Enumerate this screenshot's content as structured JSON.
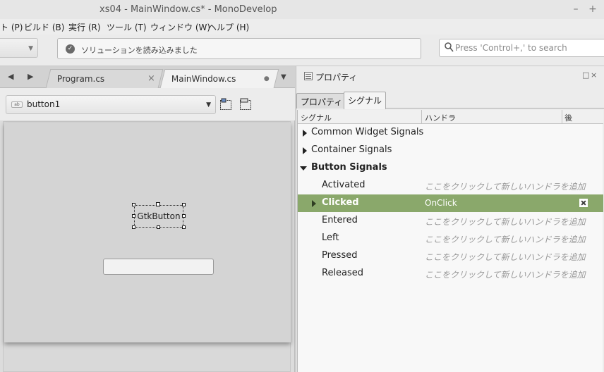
{
  "window": {
    "title": "xs04 - MainWindow.cs* - MonoDevelop",
    "minimize": "–",
    "maximize": "+"
  },
  "menu": [
    "ト (P)",
    "ビルド (B)",
    "実行 (R)",
    "ツール (T)",
    "ウィンドウ (W)",
    "ヘルプ (H)"
  ],
  "toolbar": {
    "status": "ソリューションを読み込みました",
    "search_placeholder": "Press 'Control+,' to search"
  },
  "documents": {
    "tabs": [
      {
        "label": "Program.cs",
        "close": "×",
        "active": false
      },
      {
        "label": "MainWindow.cs",
        "close": "●",
        "active": true
      }
    ]
  },
  "designer": {
    "selected_widget": "button1",
    "button_label": "GtkButton"
  },
  "properties_pad": {
    "title": "プロパティ",
    "tabs": [
      "プロパティ",
      "シグナル"
    ],
    "active_tab": "シグナル",
    "columns": [
      "シグナル",
      "ハンドラ",
      "後"
    ],
    "rows": [
      {
        "label": "Common Widget Signals",
        "level": 0,
        "expander": "closed",
        "handler": "",
        "bold": false
      },
      {
        "label": "Container Signals",
        "level": 0,
        "expander": "closed",
        "handler": "",
        "bold": false
      },
      {
        "label": "Button Signals",
        "level": 0,
        "expander": "open",
        "handler": "",
        "bold": true
      },
      {
        "label": "Activated",
        "level": 1,
        "expander": "none",
        "handler": "ここをクリックして新しいハンドラを追加",
        "bold": false
      },
      {
        "label": "Clicked",
        "level": 1,
        "expander": "closed",
        "handler": "OnClick",
        "bold": true,
        "selected": true
      },
      {
        "label": "Entered",
        "level": 1,
        "expander": "none",
        "handler": "ここをクリックして新しいハンドラを追加",
        "bold": false
      },
      {
        "label": "Left",
        "level": 1,
        "expander": "none",
        "handler": "ここをクリックして新しいハンドラを追加",
        "bold": false
      },
      {
        "label": "Pressed",
        "level": 1,
        "expander": "none",
        "handler": "ここをクリックして新しいハンドラを追加",
        "bold": false
      },
      {
        "label": "Released",
        "level": 1,
        "expander": "none",
        "handler": "ここをクリックして新しいハンドラを追加",
        "bold": false
      }
    ]
  },
  "colors": {
    "selection": "#8aa86b",
    "placeholder_handler": "#999999"
  }
}
